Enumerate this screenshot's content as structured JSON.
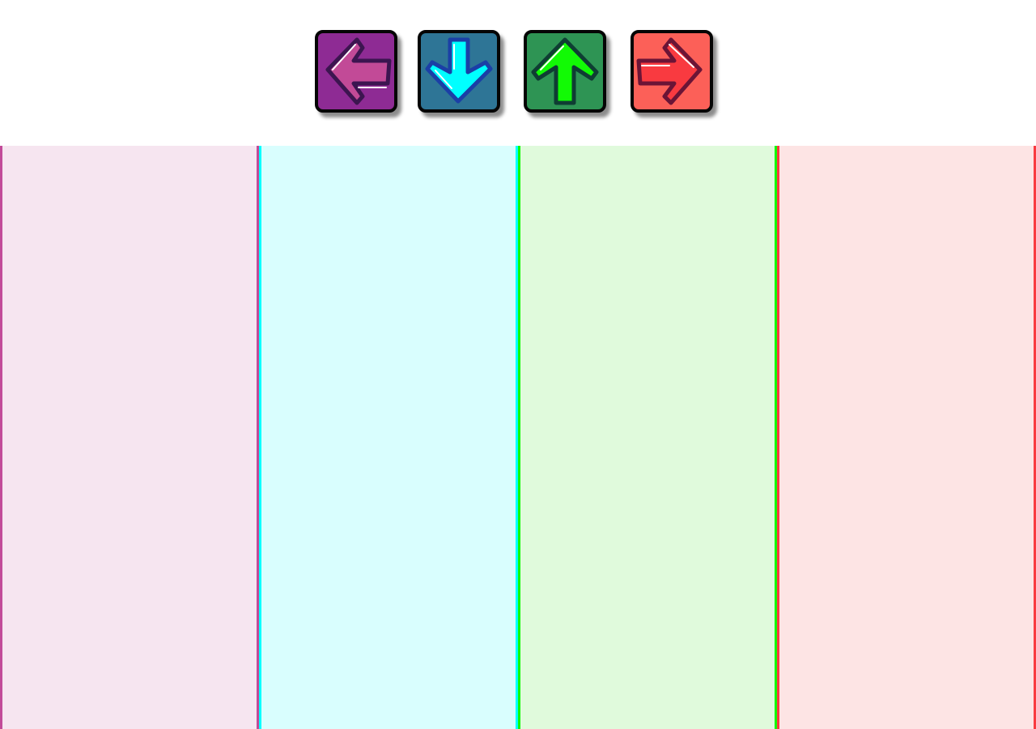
{
  "controls": {
    "keys": [
      {
        "name": "left-arrow-key",
        "icon": "left-arrow-icon",
        "bg": "#8e2b94",
        "arrow_fill": "#c24a97",
        "arrow_stroke": "#3c1550"
      },
      {
        "name": "down-arrow-key",
        "icon": "down-arrow-icon",
        "bg": "#2e7596",
        "arrow_fill": "#00ffff",
        "arrow_stroke": "#1b3fa6"
      },
      {
        "name": "up-arrow-key",
        "icon": "up-arrow-icon",
        "bg": "#2e9454",
        "arrow_fill": "#12fa05",
        "arrow_stroke": "#0f3d33"
      },
      {
        "name": "right-arrow-key",
        "icon": "right-arrow-icon",
        "bg": "#fc6058",
        "arrow_fill": "#f93a40",
        "arrow_stroke": "#6b1436"
      }
    ]
  },
  "lanes": [
    {
      "name": "left-lane",
      "color": "#f6e5f0",
      "accent": "#c24b99"
    },
    {
      "name": "down-lane",
      "color": "#d9fefe",
      "accent": "#00ffff"
    },
    {
      "name": "up-lane",
      "color": "#e0fadc",
      "accent": "#12fa05"
    },
    {
      "name": "right-lane",
      "color": "#fde4e4",
      "accent": "#f93a40"
    }
  ]
}
